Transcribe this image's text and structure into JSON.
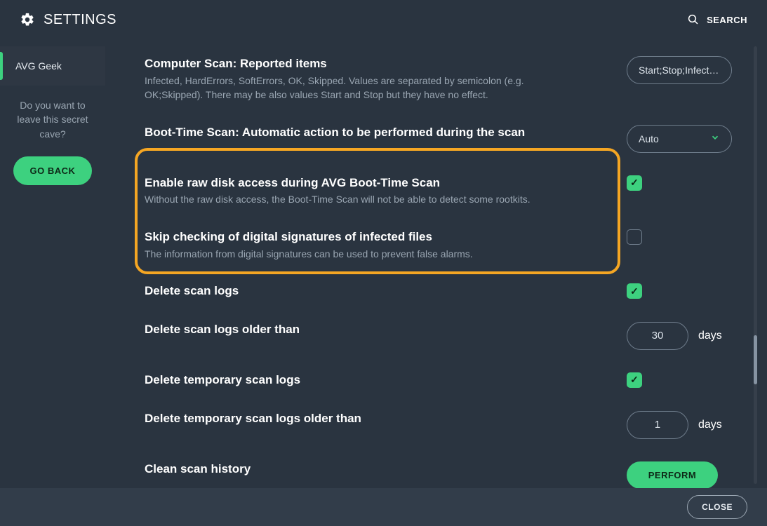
{
  "header": {
    "title": "SETTINGS",
    "search_label": "SEARCH"
  },
  "sidebar": {
    "item_label": "AVG Geek",
    "question": "Do you want to leave this secret cave?",
    "go_back_label": "GO BACK"
  },
  "settings": [
    {
      "title": "Computer Scan: Reported items",
      "desc": "Infected, HardErrors, SoftErrors, OK, Skipped. Values are separated by semicolon (e.g. OK;Skipped). There may be also values Start and Stop but they have no effect.",
      "control_type": "text",
      "value": "Start;Stop;Infected;HardErrors;SoftErrors"
    },
    {
      "title": "Boot-Time Scan: Automatic action to be performed during the scan",
      "desc": "",
      "control_type": "select",
      "value": "Auto"
    },
    {
      "title": "Enable raw disk access during AVG Boot-Time Scan",
      "desc": "Without the raw disk access, the Boot-Time Scan will not be able to detect some rootkits.",
      "control_type": "checkbox",
      "checked": true
    },
    {
      "title": "Skip checking of digital signatures of infected files",
      "desc": "The information from digital signatures can be used to prevent false alarms.",
      "control_type": "checkbox",
      "checked": false
    },
    {
      "title": "Delete scan logs",
      "desc": "",
      "control_type": "checkbox",
      "checked": true
    },
    {
      "title": "Delete scan logs older than",
      "desc": "",
      "control_type": "number",
      "value": "30",
      "unit": "days"
    },
    {
      "title": "Delete temporary scan logs",
      "desc": "",
      "control_type": "checkbox",
      "checked": true
    },
    {
      "title": "Delete temporary scan logs older than",
      "desc": "",
      "control_type": "number",
      "value": "1",
      "unit": "days"
    },
    {
      "title": "Clean scan history",
      "desc": "",
      "control_type": "button",
      "button_label": "PERFORM"
    }
  ],
  "footer": {
    "close_label": "CLOSE"
  }
}
